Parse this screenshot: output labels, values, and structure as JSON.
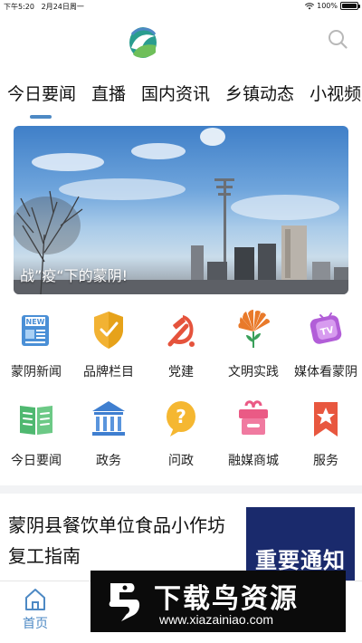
{
  "status_bar": {
    "time": "下午5:20",
    "date": "2月24日周一",
    "battery": "100%",
    "battery_level": 1.0
  },
  "tabs": [
    {
      "label": "今日要闻",
      "active": true
    },
    {
      "label": "直播"
    },
    {
      "label": "国内资讯"
    },
    {
      "label": "乡镇动态"
    },
    {
      "label": "小视频"
    },
    {
      "label": "|"
    }
  ],
  "banner": {
    "caption": "战”疫“下的蒙阴!"
  },
  "grid": [
    {
      "label": "蒙阴新闻",
      "icon": "newspaper-icon"
    },
    {
      "label": "品牌栏目",
      "icon": "shield-check-icon"
    },
    {
      "label": "党建",
      "icon": "party-emblem-icon"
    },
    {
      "label": "文明实践",
      "icon": "fan-flower-icon"
    },
    {
      "label": "媒体看蒙阴",
      "icon": "tv-icon"
    },
    {
      "label": "今日要闻",
      "icon": "open-book-icon"
    },
    {
      "label": "政务",
      "icon": "government-building-icon"
    },
    {
      "label": "问政",
      "icon": "question-bubble-icon"
    },
    {
      "label": "融媒商城",
      "icon": "gift-shop-icon"
    },
    {
      "label": "服务",
      "icon": "star-bookmark-icon"
    }
  ],
  "news": [
    {
      "title": "蒙阴县餐饮单位食品小作坊复工指南",
      "thumb_text": "重要通知"
    }
  ],
  "bottom_nav": {
    "home_label": "首页"
  },
  "watermark": {
    "title": "下载鸟资源",
    "url": "www.xiazainiao.com"
  },
  "colors": {
    "accent": "#4d89c4",
    "thumb_bg": "#1a2a6c"
  }
}
